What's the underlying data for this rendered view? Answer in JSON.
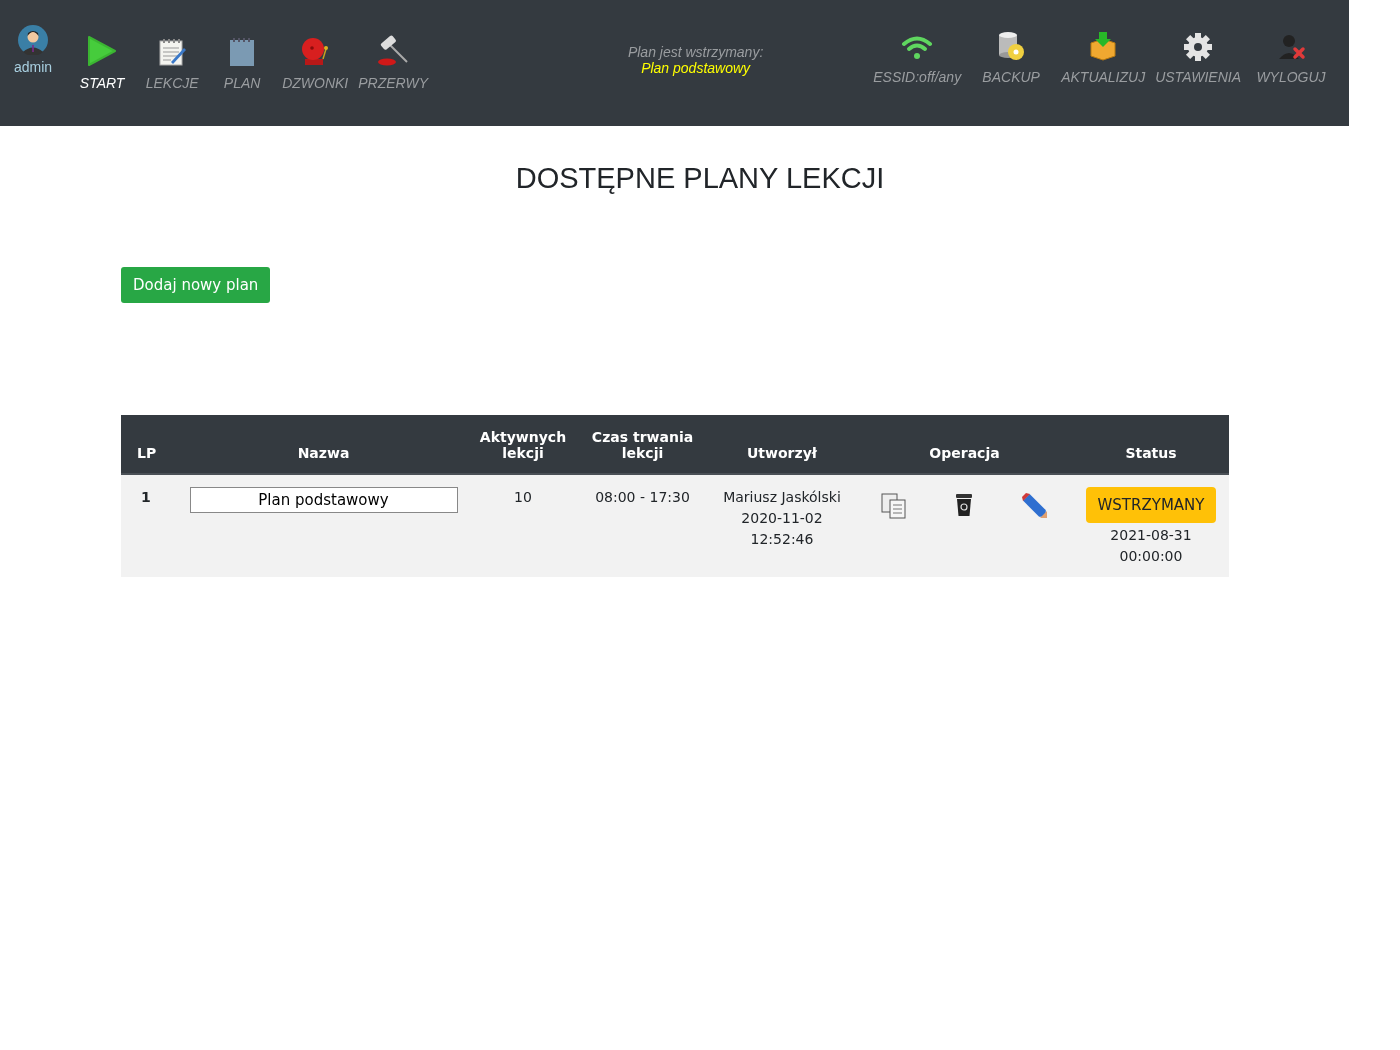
{
  "user": {
    "name": "admin"
  },
  "nav_left": [
    {
      "kind": "play",
      "label": "START",
      "selected": true
    },
    {
      "kind": "notepad",
      "label": "LEKCJE",
      "selected": false
    },
    {
      "kind": "notebook",
      "label": "PLAN",
      "selected": false
    },
    {
      "kind": "bell",
      "label": "DZWONKI",
      "selected": false
    },
    {
      "kind": "gavel",
      "label": "PRZERWY",
      "selected": false
    }
  ],
  "plan_status": {
    "line_1": "Plan jest wstrzymany:",
    "line_2": "Plan podstawowy"
  },
  "nav_right": [
    {
      "kind": "wifi",
      "label": "ESSID:off/any"
    },
    {
      "kind": "database",
      "label": "BACKUP"
    },
    {
      "kind": "box",
      "label": "AKTUALIZUJ"
    },
    {
      "kind": "gear",
      "label": "USTAWIENIA"
    },
    {
      "kind": "logout",
      "label": "WYLOGUJ"
    }
  ],
  "page_title": "DOSTĘPNE PLANY LEKCJI",
  "add_button": "Dodaj nowy plan",
  "table": {
    "columns": [
      "LP",
      "Nazwa",
      "Aktywnych lekcji",
      "Czas trwania lekcji",
      "Utworzył",
      "Operacja",
      "Status"
    ],
    "rows": [
      {
        "lp": "1",
        "name": "Plan podstawowy",
        "active_lessons": "10",
        "duration": "08:00 - 17:30",
        "created_by": [
          "Mariusz Jaskólski",
          "2020-11-02",
          "12:52:46"
        ],
        "status_button": "WSTRZYMANY",
        "status_date": [
          "2021-08-31",
          "00:00:00"
        ]
      }
    ]
  }
}
